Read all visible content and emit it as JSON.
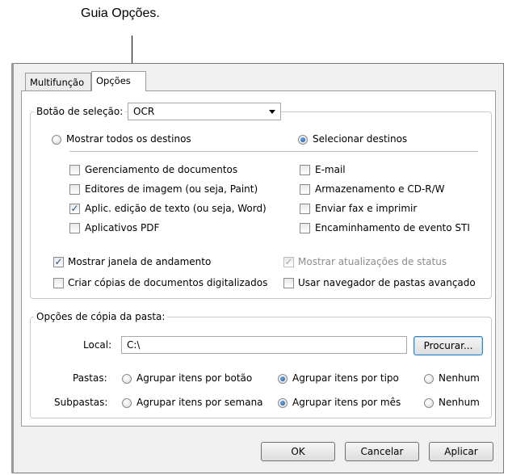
{
  "callout": {
    "text": "Guia Opções."
  },
  "tabs": [
    {
      "label": "Multifunção",
      "active": false
    },
    {
      "label": "Opções",
      "active": true
    }
  ],
  "selection": {
    "label": "Botão de seleção:",
    "value": "OCR"
  },
  "destinations": {
    "show_all": {
      "label": "Mostrar todos os destinos",
      "selected": false
    },
    "select": {
      "label": "Selecionar destinos",
      "selected": true
    },
    "left_items": [
      {
        "label": "Gerenciamento de documentos",
        "checked": false
      },
      {
        "label": "Editores de imagem (ou seja, Paint)",
        "checked": false
      },
      {
        "label": "Aplic. edição de texto (ou seja, Word)",
        "checked": true
      },
      {
        "label": "Aplicativos PDF",
        "checked": false
      }
    ],
    "right_items": [
      {
        "label": "E-mail",
        "checked": false
      },
      {
        "label": "Armazenamento e CD-R/W",
        "checked": false
      },
      {
        "label": "Enviar fax e imprimir",
        "checked": false
      },
      {
        "label": "Encaminhamento de evento STI",
        "checked": false
      }
    ]
  },
  "options": {
    "progress": {
      "label": "Mostrar janela de andamento",
      "checked": true
    },
    "status_updates": {
      "label": "Mostrar atualizações de status",
      "checked": true,
      "disabled": true
    },
    "copies": {
      "label": "Criar cópias de documentos digitalizados",
      "checked": false
    },
    "advanced_browser": {
      "label": "Usar navegador de pastas avançado",
      "checked": false
    }
  },
  "folder_copy": {
    "legend": "Opções de cópia da pasta:",
    "local_label": "Local:",
    "local_value": "C:\\",
    "browse_label": "Procurar...",
    "folders_label": "Pastas:",
    "subfolders_label": "Subpastas:",
    "folders_options": [
      {
        "label": "Agrupar itens por botão",
        "selected": false
      },
      {
        "label": "Agrupar itens por tipo",
        "selected": true
      },
      {
        "label": "Nenhum",
        "selected": false
      }
    ],
    "subfolders_options": [
      {
        "label": "Agrupar itens por semana",
        "selected": false
      },
      {
        "label": "Agrupar itens por mês",
        "selected": true
      },
      {
        "label": "Nenhum",
        "selected": false
      }
    ]
  },
  "buttons": {
    "ok": "OK",
    "cancel": "Cancelar",
    "apply": "Aplicar"
  }
}
